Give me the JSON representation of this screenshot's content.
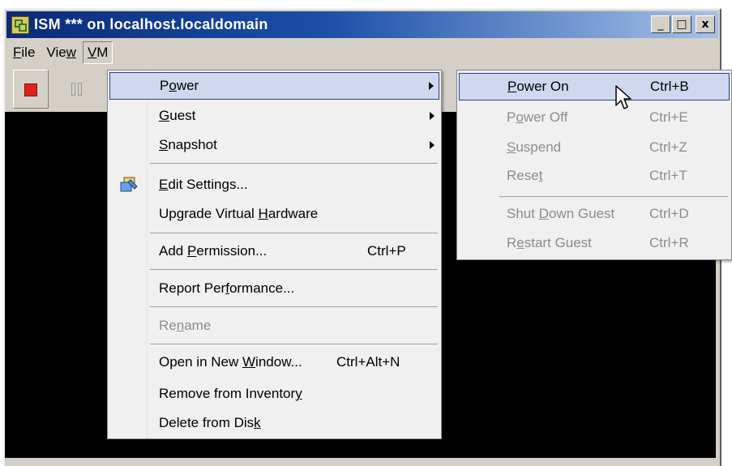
{
  "window": {
    "title": "ISM *** on localhost.localdomain",
    "controls": [
      "_",
      "□",
      "x"
    ]
  },
  "menubar": {
    "items": [
      {
        "pre": "",
        "u": "F",
        "post": "ile"
      },
      {
        "pre": "Vie",
        "u": "w",
        "post": ""
      },
      {
        "pre": "",
        "u": "V",
        "post": "M"
      }
    ]
  },
  "toolbar": {
    "buttons": [
      {
        "icon": "stop-icon",
        "color": "#e02020"
      },
      {
        "icon": "pause-icon",
        "state": "disabled"
      }
    ]
  },
  "vm_menu": {
    "items": [
      {
        "pre": "P",
        "u": "o",
        "post": "wer",
        "submenu": true,
        "highlighted": true
      },
      {
        "pre": "",
        "u": "G",
        "post": "uest",
        "submenu": true
      },
      {
        "pre": "",
        "u": "S",
        "post": "napshot",
        "submenu": true
      },
      {
        "pre": "",
        "u": "E",
        "post": "dit Settings...",
        "icon": "edit-settings-icon"
      },
      {
        "pre": "Upgrade Virtual ",
        "u": "H",
        "post": "ardware"
      },
      {
        "pre": "Add ",
        "u": "P",
        "post": "ermission...",
        "shortcut": "Ctrl+P"
      },
      {
        "pre": "Report Per",
        "u": "f",
        "post": "ormance..."
      },
      {
        "pre": "Re",
        "u": "n",
        "post": "ame",
        "disabled": true
      },
      {
        "pre": "Open in New ",
        "u": "W",
        "post": "indow...",
        "shortcut": "Ctrl+Alt+N"
      },
      {
        "pre": "Remove from Inventor",
        "u": "y",
        "post": ""
      },
      {
        "pre": "Delete from Dis",
        "u": "k",
        "post": ""
      }
    ]
  },
  "power_submenu": {
    "items": [
      {
        "pre": "",
        "u": "P",
        "post": "ower On",
        "shortcut": "Ctrl+B",
        "highlighted": true
      },
      {
        "pre": "P",
        "u": "o",
        "post": "wer Off",
        "shortcut": "Ctrl+E",
        "disabled": true
      },
      {
        "pre": "",
        "u": "S",
        "post": "uspend",
        "shortcut": "Ctrl+Z",
        "disabled": true
      },
      {
        "pre": "Rese",
        "u": "t",
        "post": "",
        "shortcut": "Ctrl+T",
        "disabled": true
      },
      {
        "pre": "Shut ",
        "u": "D",
        "post": "own Guest",
        "shortcut": "Ctrl+D",
        "disabled": true
      },
      {
        "pre": "R",
        "u": "e",
        "post": "start Guest",
        "shortcut": "Ctrl+R",
        "disabled": true
      }
    ]
  },
  "colors": {
    "titlebar_start": "#0b2a7a",
    "titlebar_end": "#a6c2ea",
    "highlight_bg": "#cfd8ee",
    "highlight_border": "#2a3f8f",
    "disabled_text": "#8c8c8c",
    "console_bg": "#000000"
  }
}
